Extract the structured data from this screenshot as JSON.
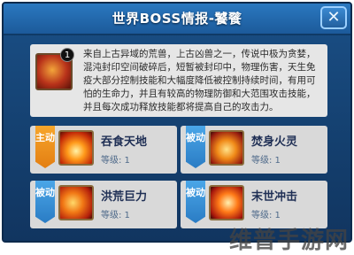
{
  "window": {
    "title": "世界BOSS情报-饕餮",
    "close_symbol": "✕"
  },
  "boss": {
    "badge": "1",
    "description": "来自上古异域的荒兽，上古凶兽之一，传说中极为贪婪，混沌封印空间破碎后，短暂被封印中，物理伤害，天生免疫大部分控制技能和大幅度降低被控制持续时间，有用可怕的生命力，并且有较高的物理防御和大范围攻击技能，并且每次成功释放技能都将提高自己的攻击力。"
  },
  "skills": [
    {
      "type": "主动",
      "name": "吞食天地",
      "level": "等级: 1",
      "icon": "fire-burst-icon"
    },
    {
      "type": "被动",
      "name": "焚身火灵",
      "level": "等级: 1",
      "icon": "fire-spirit-icon"
    },
    {
      "type": "被动",
      "name": "洪荒巨力",
      "level": "等级: 1",
      "icon": "flame-claw-icon"
    },
    {
      "type": "被动",
      "name": "末世冲击",
      "level": "等级: 1",
      "icon": "fire-impact-icon"
    }
  ],
  "watermark": "维普手游网",
  "colors": {
    "panel": "#1a4f86",
    "active_tag": "#f7a62b",
    "passive_tag": "#4aa6e8"
  }
}
